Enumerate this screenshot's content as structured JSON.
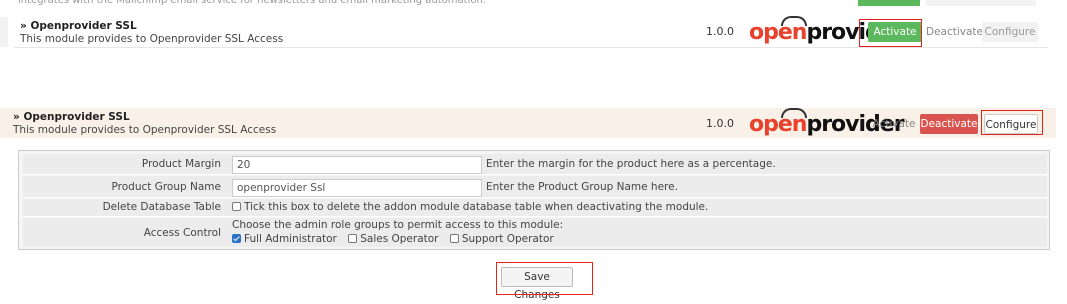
{
  "top": {
    "cut_text": "integrates with the Mailchimp email service for newsletters and email marketing automation."
  },
  "modules": [
    {
      "title": "» Openprovider SSL",
      "description": "This module provides to Openprovider SSL Access",
      "version": "1.0.0",
      "logo": {
        "part1": "open",
        "part2": "provider"
      },
      "buttons": {
        "activate": "Activate",
        "deactivate": "Deactivate",
        "configure": "Configure"
      }
    },
    {
      "title": "» Openprovider SSL",
      "description": "This module provides to Openprovider SSL Access",
      "version": "1.0.0",
      "logo": {
        "part1": "open",
        "part2": "provider"
      },
      "buttons": {
        "activate": "Activate",
        "deactivate": "Deactivate",
        "configure": "Configure"
      }
    }
  ],
  "config": {
    "product_margin": {
      "label": "Product Margin",
      "value": "20",
      "help": "Enter the margin for the product here as a percentage."
    },
    "product_group_name": {
      "label": "Product Group Name",
      "value": "openprovider Ssl",
      "help": "Enter the Product Group Name here."
    },
    "delete_table": {
      "label": "Delete Database Table",
      "help": "Tick this box to delete the addon module database table when deactivating the module.",
      "checked": false
    },
    "access_control": {
      "label": "Access Control",
      "help": "Choose the admin role groups to permit access to this module:",
      "options": [
        {
          "label": "Full Administrator",
          "checked": true
        },
        {
          "label": "Sales Operator",
          "checked": false
        },
        {
          "label": "Support Operator",
          "checked": false
        }
      ]
    }
  },
  "save_label": "Save Changes",
  "colors": {
    "accent_red": "#e2231a",
    "activate_green": "#5cb85c",
    "deactivate_red": "#d9534f",
    "highlight_row": "#f9f0e8"
  }
}
